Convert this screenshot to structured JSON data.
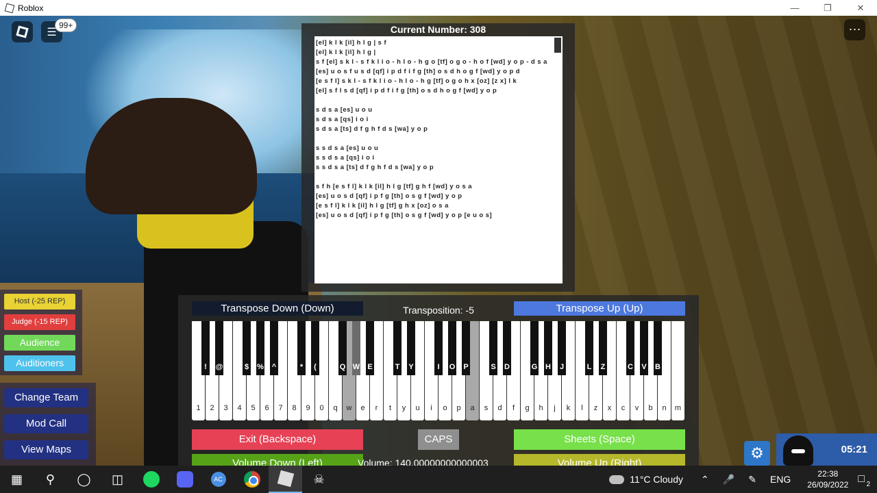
{
  "window": {
    "title": "Roblox",
    "minimize_icon": "minimize-icon",
    "maximize_icon": "restore-icon",
    "close_icon": "close-icon"
  },
  "hud": {
    "chat_badge": "99+",
    "menu_icon": "more-icon"
  },
  "sheet": {
    "title": "Current Number: 308",
    "lines": [
      "[el] k l k [il] h l g | s f",
      "[el] k l k [il] h l g |",
      "s f [el] s k l - s f k l i o - h l o - h g o [tf] o g o - h o f [wd] y o p - d s a",
      "[es] u o s f u s d [qf] i p d f i f g [th] o s d h o g f [wd] y o p d",
      "[e s f l] s k l - s f k l i o - h l o - h g [tf] o g o h x [oz] [z x] l k",
      "[el] s f l s d [qf] i p d f i f g [th] o s d h o g f [wd] y o p",
      "",
      "s d s a [es] u o u",
      "s d s a [qs] i o i",
      "s d s a [ts] d f g h f d s [wa] y o p",
      "",
      "s s d s a [es] u o u",
      "s s d s a [qs] i o i",
      "s s d s a [ts] d f g h f d s [wa] y o p",
      "",
      "s f h [e s f l] k l k [il] h l g [tf] g h f [wd] y o s a",
      "[es] u o s d [qf] i p f g [th] o s g f [wd] y o p",
      "[e s f l] k l k [il] h l g [tf] g h x [oz] o s a",
      "[es] u o s d [qf] i p f g [th] o s g f [wd] y o p [e u o s]"
    ]
  },
  "piano": {
    "transpose_down": "Transpose Down (Down)",
    "transposition": "Transposition: -5",
    "transpose_up": "Transpose Up (Up)",
    "white_keys": [
      "1",
      "2",
      "3",
      "4",
      "5",
      "6",
      "7",
      "8",
      "9",
      "0",
      "q",
      "w",
      "e",
      "r",
      "t",
      "y",
      "u",
      "i",
      "o",
      "p",
      "a",
      "s",
      "d",
      "f",
      "g",
      "h",
      "j",
      "k",
      "l",
      "z",
      "x",
      "c",
      "v",
      "b",
      "n",
      "m"
    ],
    "pressed_white": [
      "w",
      "a"
    ],
    "black_keys": [
      {
        "after": 0,
        "label": "!"
      },
      {
        "after": 1,
        "label": "@"
      },
      {
        "after": 3,
        "label": "$"
      },
      {
        "after": 4,
        "label": "%"
      },
      {
        "after": 5,
        "label": "^"
      },
      {
        "after": 7,
        "label": "*"
      },
      {
        "after": 8,
        "label": "("
      },
      {
        "after": 10,
        "label": "Q"
      },
      {
        "after": 11,
        "label": "W"
      },
      {
        "after": 12,
        "label": "E"
      },
      {
        "after": 14,
        "label": "T"
      },
      {
        "after": 15,
        "label": "Y"
      },
      {
        "after": 17,
        "label": "I"
      },
      {
        "after": 18,
        "label": "O"
      },
      {
        "after": 19,
        "label": "P"
      },
      {
        "after": 21,
        "label": "S"
      },
      {
        "after": 22,
        "label": "D"
      },
      {
        "after": 24,
        "label": "G"
      },
      {
        "after": 25,
        "label": "H"
      },
      {
        "after": 26,
        "label": "J"
      },
      {
        "after": 28,
        "label": "L"
      },
      {
        "after": 29,
        "label": "Z"
      },
      {
        "after": 31,
        "label": "C"
      },
      {
        "after": 32,
        "label": "V"
      },
      {
        "after": 33,
        "label": "B"
      }
    ],
    "pressed_black": [
      "W"
    ],
    "exit": "Exit (Backspace)",
    "caps": "CAPS",
    "sheets": "Sheets (Space)",
    "volume_down": "Volume Down (Left)",
    "volume": "Volume: 140.00000000000003",
    "volume_up": "Volume Up (Right)"
  },
  "roles": {
    "host": "Host (-25 REP)",
    "judge": "Judge (-15 REP)",
    "audience": "Audience",
    "auditioners": "Auditioners"
  },
  "team": {
    "change_team": "Change Team",
    "mod_call": "Mod Call",
    "view_maps": "View Maps"
  },
  "timer": "05:21",
  "taskbar": {
    "weather": "11°C  Cloudy",
    "language": "ENG",
    "time": "22:38",
    "date": "26/09/2022",
    "notification_count": "2",
    "ac_label": "AC"
  },
  "colors": {
    "transpose_up": "#4d78de",
    "exit": "#e64155",
    "sheets": "#77e04a",
    "volume_down": "#56a318",
    "volume_up": "#b5b82a",
    "team_button": "#233182"
  }
}
